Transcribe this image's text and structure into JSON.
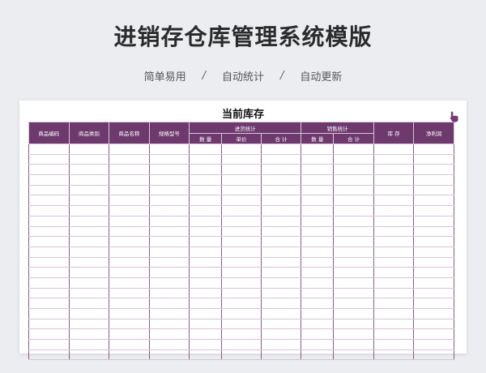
{
  "header": {
    "title": "进销存仓库管理系统模版",
    "features": [
      "简单易用",
      "自动统计",
      "自动更新"
    ],
    "separator": "/"
  },
  "sheet": {
    "title": "当前库存",
    "columns": {
      "code": "商品编码",
      "category": "商品类别",
      "name": "商品名称",
      "spec": "规格型号",
      "purchase_group": "进货统计",
      "purchase_qty": "数 量",
      "purchase_price": "单价",
      "purchase_total": "合 计",
      "sales_group": "销售统计",
      "sales_qty": "数 量",
      "sales_total": "合 计",
      "stock": "库 存",
      "profit": "净利润"
    },
    "empty_rows": 21
  },
  "colors": {
    "header_bg": "#6e3a6e",
    "background": "#ebedf1"
  },
  "icons": [
    "pointer-hand-icon"
  ]
}
